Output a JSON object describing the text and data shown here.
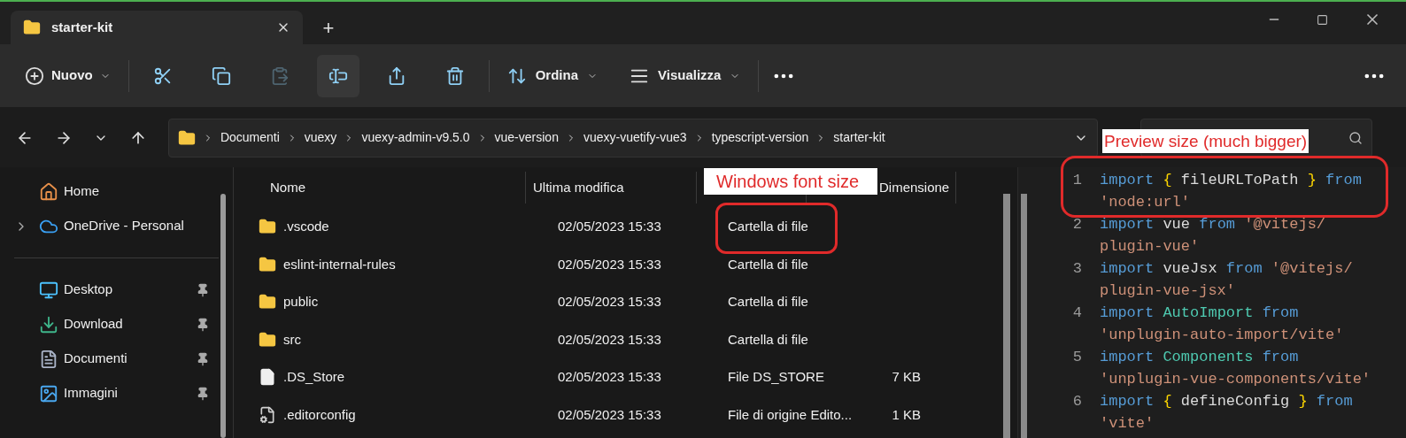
{
  "tabs": [
    {
      "title": "starter-kit",
      "selected": true
    }
  ],
  "new_tab": "+",
  "toolbar": {
    "new": "Nuovo",
    "actions": [
      {
        "kind": "cut",
        "disabled": false,
        "highlighted": false
      },
      {
        "kind": "copy",
        "disabled": false,
        "highlighted": false
      },
      {
        "kind": "paste",
        "disabled": true,
        "highlighted": false
      },
      {
        "kind": "rename",
        "disabled": false,
        "highlighted": true
      },
      {
        "kind": "share",
        "disabled": false,
        "highlighted": false
      },
      {
        "kind": "delete",
        "disabled": false,
        "highlighted": false
      }
    ],
    "sort": "Ordina",
    "view": "Visualizza"
  },
  "address": {
    "breadcrumbs": [
      "Documenti",
      "vuexy",
      "vuexy-admin-v9.5.0",
      "vue-version",
      "vuexy-vuetify-vue3",
      "typescript-version",
      "starter-kit"
    ]
  },
  "sidebar": {
    "items": [
      {
        "kind": "home",
        "label": "Home",
        "pinned": false,
        "expandable": false
      },
      {
        "kind": "cloud",
        "label": "OneDrive - Personal",
        "pinned": false,
        "expandable": true
      },
      {
        "kind": "divider"
      },
      {
        "kind": "desktop",
        "label": "Desktop",
        "pinned": true,
        "expandable": false
      },
      {
        "kind": "download",
        "label": "Download",
        "pinned": true,
        "expandable": false
      },
      {
        "kind": "documents",
        "label": "Documenti",
        "pinned": true,
        "expandable": false
      },
      {
        "kind": "pictures",
        "label": "Immagini",
        "pinned": true,
        "expandable": false
      }
    ]
  },
  "file_list": {
    "columns": [
      "Nome",
      "Ultima modifica",
      "Dimensione"
    ],
    "rows": [
      {
        "kind": "folder",
        "name": ".vscode",
        "modified": "02/05/2023 15:33",
        "type": "Cartella di file"
      },
      {
        "kind": "folder",
        "name": "eslint-internal-rules",
        "modified": "02/05/2023 15:33",
        "type": "Cartella di file"
      },
      {
        "kind": "folder",
        "name": "public",
        "modified": "02/05/2023 15:33",
        "type": "Cartella di file"
      },
      {
        "kind": "folder",
        "name": "src",
        "modified": "02/05/2023 15:33",
        "type": "Cartella di file"
      },
      {
        "kind": "file",
        "name": ".DS_Store",
        "modified": "02/05/2023 15:33",
        "type": "File DS_STORE",
        "size": "7 KB"
      },
      {
        "kind": "config",
        "name": ".editorconfig",
        "modified": "02/05/2023 15:33",
        "type": "File di origine Edito...",
        "size": "1 KB"
      }
    ]
  },
  "preview": {
    "lines": [
      {
        "number": "1",
        "rows": [
          [
            {
              "kind": "keyword",
              "text": "import "
            },
            {
              "kind": "brace",
              "text": "{ "
            },
            {
              "kind": "plain",
              "text": "fileURLToPath "
            },
            {
              "kind": "brace",
              "text": "} "
            },
            {
              "kind": "keyword",
              "text": "from"
            }
          ],
          [
            {
              "kind": "string",
              "text": "'node:url'"
            }
          ]
        ]
      },
      {
        "number": "2",
        "rows": [
          [
            {
              "kind": "keyword",
              "text": "import "
            },
            {
              "kind": "plain",
              "text": "vue "
            },
            {
              "kind": "keyword",
              "text": "from "
            },
            {
              "kind": "string",
              "text": "'@vitejs/"
            }
          ],
          [
            {
              "kind": "string",
              "text": "plugin-vue'"
            }
          ]
        ]
      },
      {
        "number": "3",
        "rows": [
          [
            {
              "kind": "keyword",
              "text": "import "
            },
            {
              "kind": "plain",
              "text": "vueJsx "
            },
            {
              "kind": "keyword",
              "text": "from "
            },
            {
              "kind": "string",
              "text": "'@vitejs/"
            }
          ],
          [
            {
              "kind": "string",
              "text": "plugin-vue-jsx'"
            }
          ]
        ]
      },
      {
        "number": "4",
        "rows": [
          [
            {
              "kind": "keyword",
              "text": "import "
            },
            {
              "kind": "class",
              "text": "AutoImport "
            },
            {
              "kind": "keyword",
              "text": "from"
            }
          ],
          [
            {
              "kind": "string",
              "text": "'unplugin-auto-import/vite'"
            }
          ]
        ]
      },
      {
        "number": "5",
        "rows": [
          [
            {
              "kind": "keyword",
              "text": "import "
            },
            {
              "kind": "class",
              "text": "Components "
            },
            {
              "kind": "keyword",
              "text": "from"
            }
          ],
          [
            {
              "kind": "string",
              "text": "'unplugin-vue-components/vite'"
            }
          ]
        ]
      },
      {
        "number": "6",
        "rows": [
          [
            {
              "kind": "keyword",
              "text": "import "
            },
            {
              "kind": "brace",
              "text": "{ "
            },
            {
              "kind": "plain",
              "text": "defineConfig "
            },
            {
              "kind": "brace",
              "text": "} "
            },
            {
              "kind": "keyword",
              "text": "from"
            }
          ],
          [
            {
              "kind": "string",
              "text": "'vite'"
            }
          ]
        ]
      }
    ]
  },
  "annotations": [
    {
      "kind": "type_label",
      "text": "Windows font size"
    },
    {
      "kind": "preview_label",
      "text": "Preview size (much bigger)"
    }
  ]
}
